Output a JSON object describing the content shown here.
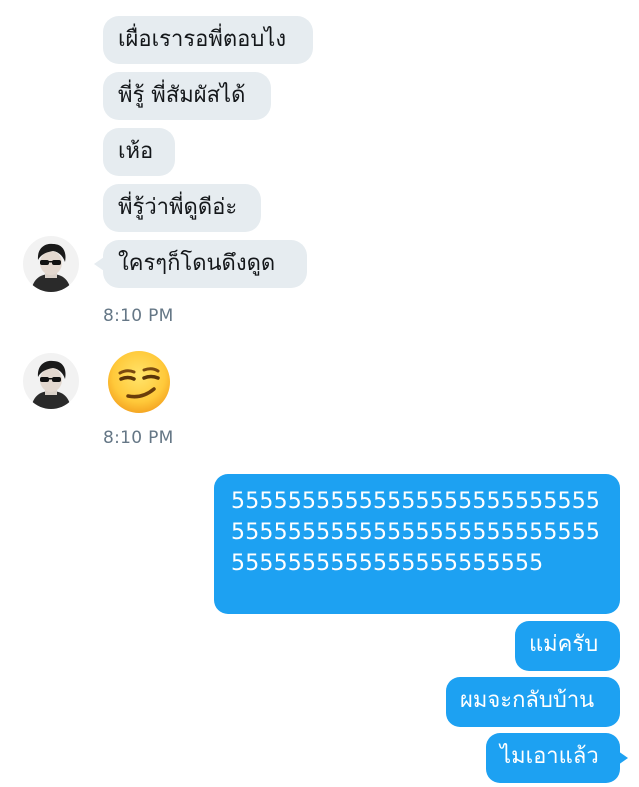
{
  "conversation": {
    "incoming": [
      {
        "text": "เผื่อเรารอพี่ตอบไง"
      },
      {
        "text": "พี่รู้ พี่สัมผัสได้"
      },
      {
        "text": "เห้อ"
      },
      {
        "text": "พี่รู้ว่าพี่ดูดีอ่ะ"
      },
      {
        "text": "ใครๆก็โดนดึงดูด"
      }
    ],
    "timestamp_1": "8:10 PM",
    "emoji_message": {
      "icon": "smirking-face-emoji"
    },
    "timestamp_2": "8:10 PM",
    "outgoing": [
      {
        "text": "55555555555555555555555555555555555555555555555555555555555555555555555555"
      },
      {
        "text": "แม่ครับ"
      },
      {
        "text": "ผมจะกลับบ้าน"
      },
      {
        "text": "ไมเอาแล้ว"
      }
    ]
  },
  "colors": {
    "incoming_bubble": "#e6ecf0",
    "outgoing_bubble": "#1da1f2",
    "timestamp": "#657786"
  }
}
